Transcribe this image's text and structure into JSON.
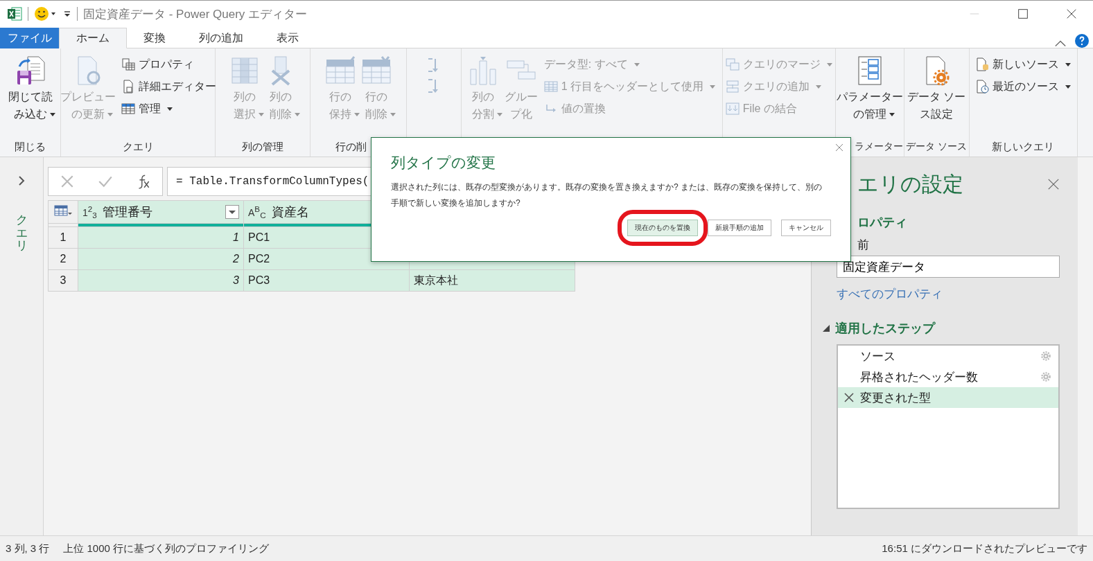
{
  "window": {
    "title": "固定資産データ - Power Query エディター"
  },
  "tabs": [
    {
      "label": "ファイル",
      "kind": "file",
      "selected": false
    },
    {
      "label": "ホーム",
      "kind": "tab",
      "selected": true
    },
    {
      "label": "変換",
      "kind": "tab",
      "selected": false
    },
    {
      "label": "列の追加",
      "kind": "tab",
      "selected": false
    },
    {
      "label": "表示",
      "kind": "tab",
      "selected": false
    }
  ],
  "ribbon": {
    "groups": [
      {
        "label": "閉じる",
        "items": [
          {
            "kind": "large",
            "label": "閉じて読み込む",
            "dropdown": true,
            "disabled": false
          }
        ]
      },
      {
        "label": "クエリ",
        "items": [
          {
            "kind": "large",
            "label": "プレビューの更新",
            "dropdown": true,
            "disabled": true
          },
          {
            "kind": "stack",
            "items": [
              {
                "label": "プロパティ",
                "dropdown": false,
                "disabled": false
              },
              {
                "label": "詳細エディター",
                "dropdown": false,
                "disabled": false
              },
              {
                "label": "管理",
                "dropdown": true,
                "disabled": false
              }
            ]
          }
        ]
      },
      {
        "label": "列の管理",
        "items": [
          {
            "kind": "large",
            "label": "列の選択",
            "dropdown": true,
            "disabled": true
          },
          {
            "kind": "large",
            "label": "列の削除",
            "dropdown": true,
            "disabled": true
          }
        ]
      },
      {
        "label": "行の削",
        "items": [
          {
            "kind": "large",
            "label": "行の保持",
            "dropdown": true,
            "disabled": true
          },
          {
            "kind": "large",
            "label": "行の削除",
            "dropdown": true,
            "disabled": true
          }
        ]
      },
      {
        "items": [
          {
            "kind": "sort",
            "disabled": true
          }
        ]
      },
      {
        "items": [
          {
            "kind": "large",
            "label": "列の分割",
            "dropdown": true,
            "disabled": true
          },
          {
            "kind": "large",
            "label": "グループ化",
            "dropdown": false,
            "disabled": true
          },
          {
            "kind": "stack",
            "items": [
              {
                "label": "データ型: すべて",
                "dropdown": true,
                "disabled": true
              },
              {
                "label": "1 行目をヘッダーとして使用",
                "dropdown": true,
                "disabled": true
              },
              {
                "label": "値の置換",
                "dropdown": false,
                "disabled": true
              }
            ]
          }
        ]
      },
      {
        "items": [
          {
            "kind": "stack",
            "items": [
              {
                "label": "クエリのマージ",
                "dropdown": true,
                "disabled": true
              },
              {
                "label": "クエリの追加",
                "dropdown": true,
                "disabled": true
              },
              {
                "label": "File の結合",
                "dropdown": false,
                "disabled": true
              }
            ]
          }
        ]
      },
      {
        "label": "ラメーター",
        "items": [
          {
            "kind": "large",
            "label": "パラメーターの管理",
            "dropdown": true,
            "disabled": false
          }
        ]
      },
      {
        "label": "データ ソース",
        "items": [
          {
            "kind": "large",
            "label": "データ ソース設定",
            "dropdown": false,
            "disabled": false
          }
        ]
      },
      {
        "label": "新しいクエリ",
        "items": [
          {
            "kind": "stack",
            "items": [
              {
                "label": "新しいソース",
                "dropdown": true,
                "disabled": false
              },
              {
                "label": "最近のソース",
                "dropdown": true,
                "disabled": false
              }
            ]
          }
        ]
      }
    ]
  },
  "queries_pane": {
    "label": "クエリ"
  },
  "formula_bar": {
    "value": "= Table.TransformColumnTypes("
  },
  "table": {
    "columns": [
      {
        "type_label": "1$^{2}$$_{3}$",
        "name": "管理番号",
        "filter": true
      },
      {
        "type_label": "A$^{B}$$_{C}$",
        "name": "資産名",
        "filter": false
      },
      {}
    ],
    "rows": [
      {
        "number": "1",
        "cells": [
          "1",
          "PC1",
          ""
        ]
      },
      {
        "number": "2",
        "cells": [
          "2",
          "PC2",
          ""
        ]
      },
      {
        "number": "3",
        "cells": [
          "3",
          "PC3",
          "東京本社"
        ]
      }
    ]
  },
  "query_settings": {
    "title": "エリの設定",
    "properties_heading": "ロパティ",
    "name_label": "前",
    "name_value": "固定資産データ",
    "all_properties_link": "すべてのプロパティ",
    "steps_heading": "適用したステップ",
    "steps": [
      {
        "label": "ソース",
        "selected": false,
        "has_settings": true
      },
      {
        "label": "昇格されたヘッダー数",
        "selected": false,
        "has_settings": true
      },
      {
        "label": "変更された型",
        "selected": true,
        "has_settings": false
      }
    ]
  },
  "dialog": {
    "title": "列タイプの変更",
    "message": "選択された列には、既存の型変換があります。既存の変換を置き換えますか? または、既存の変換を保持して、別の手順で新しい変換を追加しますか?",
    "buttons": [
      {
        "label": "現在のものを置換",
        "primary": true,
        "highlighted": true
      },
      {
        "label": "新規手順の追加",
        "primary": false,
        "highlighted": false
      },
      {
        "label": "キャンセル",
        "primary": false,
        "highlighted": false
      }
    ]
  },
  "status_bar": {
    "left": "3 列, 3 行",
    "middle": "上位 1000 行に基づく列のプロファイリング",
    "right": "16:51 にダウンロードされたプレビューです"
  }
}
